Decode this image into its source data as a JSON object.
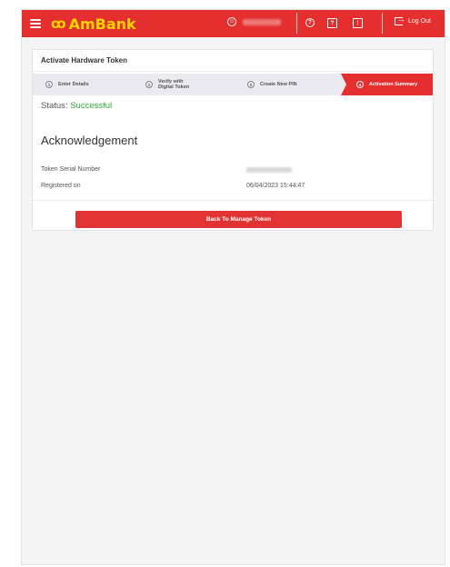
{
  "brand": {
    "logo_mark": "ꝏ",
    "name": "AmBank",
    "accent": "#e52e2e",
    "logo_color": "#ffd400"
  },
  "topbar": {
    "icons": [
      "menu-icon",
      "user-icon",
      "help-icon",
      "id-card-icon",
      "message-icon",
      "logout-icon"
    ],
    "help_glyph": "?",
    "card_glyph": "?",
    "message_glyph": "!",
    "logout_label": "Log Out"
  },
  "page": {
    "title": "Activate Hardware Token",
    "steps": [
      {
        "num": "1",
        "label": "Enter Details"
      },
      {
        "num": "2",
        "label": "Verify with Digital Token"
      },
      {
        "num": "3",
        "label": "Create New PIN"
      },
      {
        "num": "4",
        "label": "Activation Summary",
        "active": true
      }
    ],
    "status_label": "Status:",
    "status_value": "Successful",
    "status_color": "#2eaa38",
    "section_title": "Acknowledgement",
    "fields": [
      {
        "label": "Token Serial Number"
      },
      {
        "label": "Registered on",
        "value": "06/04/2023 15:44:47"
      }
    ],
    "back_button": "Back To Manage Token"
  }
}
